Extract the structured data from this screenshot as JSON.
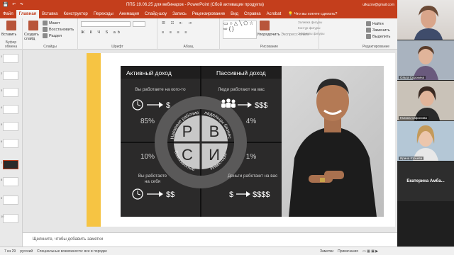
{
  "titlebar": {
    "title": "ППБ 19.06.25 для вебинаров - PowerPoint (Сбой активации продукта)",
    "user": "ulkuzov@gmail.com"
  },
  "menu": {
    "tabs": [
      "Файл",
      "Главная",
      "Вставка",
      "Конструктор",
      "Переходы",
      "Анимация",
      "Слайд-шоу",
      "Запись",
      "Рецензирование",
      "Вид",
      "Справка",
      "Acrobat"
    ],
    "active": "Главная",
    "tell_me": "Что вы хотите сделать?"
  },
  "ribbon": {
    "clipboard": {
      "paste": "Вставить",
      "label": "Буфер обмена"
    },
    "slides": {
      "new_slide": "Создать слайд",
      "layout": "Макет",
      "reset": "Восстановить",
      "section": "Раздел",
      "label": "Слайды"
    },
    "font": {
      "label": "Шрифт"
    },
    "paragraph": {
      "label": "Абзац"
    },
    "drawing": {
      "arrange": "Упорядочить",
      "quick_styles": "Экспресс-стили",
      "fill": "Заливка фигуры",
      "outline": "Контур фигуры",
      "effects": "Эффекты фигуры",
      "label": "Рисование"
    },
    "editing": {
      "find": "Найти",
      "replace": "Заменить",
      "select": "Выделить",
      "label": "Редактирование"
    }
  },
  "slide": {
    "quadrants": {
      "top_left": {
        "header": "Активный доход",
        "subtitle": "Вы работаете на кого-то",
        "money": "$",
        "percent": "85%"
      },
      "top_right": {
        "header": "Пассивный доход",
        "subtitle": "Люди работают на вас",
        "money": "$$$",
        "percent": "4%"
      },
      "bottom_left": {
        "subtitle": "Вы работаете на себя",
        "money": "$$",
        "percent": "10%"
      },
      "bottom_right": {
        "subtitle": "Деньги работают на вас",
        "money": "$$$$",
        "percent": "1%"
      }
    },
    "circle": {
      "letters": {
        "tl": "Р",
        "tr": "В",
        "bl": "С",
        "br": "И"
      },
      "arc_tl": "Наемные рабочие",
      "arc_tr": "Владельцы бизнеса",
      "arc_bl": "Самозанятые",
      "arc_br": "Инвесторы"
    }
  },
  "notes": {
    "placeholder": "Щелкните, чтобы добавить заметки"
  },
  "status": {
    "slide_counter": "7 из 29",
    "language": "русский",
    "accessibility": "Специальные возможности: все в порядке",
    "notes_btn": "Заметки",
    "comments_btn": "Примечания"
  },
  "thumbnails": [
    "1",
    "2",
    "3",
    "4",
    "5",
    "6",
    "7",
    "8",
    "9",
    "10"
  ],
  "participants": [
    {
      "name": ""
    },
    {
      "name": "Ольга Сорокина"
    },
    {
      "name": "Галина Сафонова"
    },
    {
      "name": "Ирина Юрьева"
    },
    {
      "name": "Екатерина Амба..."
    }
  ]
}
